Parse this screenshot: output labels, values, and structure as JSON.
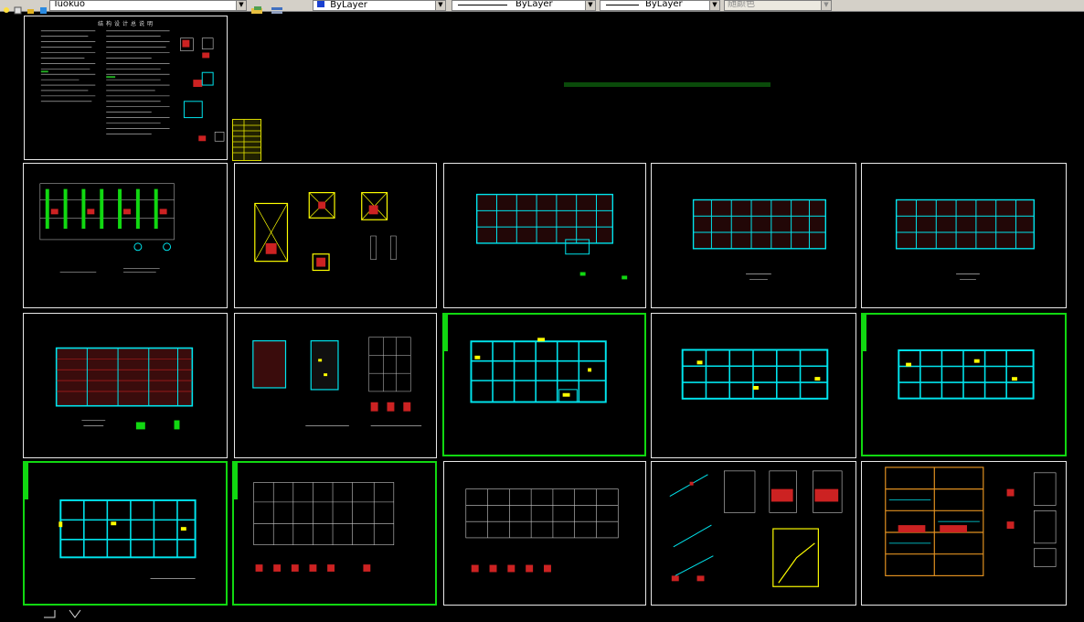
{
  "toolbar": {
    "layer_name": "Tuokuo",
    "color_combo": "ByLayer",
    "linetype_combo": "ByLayer",
    "lineweight_combo": "ByLayer",
    "plotstyle_combo": "随颜色"
  },
  "sheets": {
    "notes_title": "结构设计总说明"
  },
  "colors": {
    "background": "#000000",
    "frame": "#e8e8e8",
    "selection": "#11d811",
    "beam": "#00e5ee",
    "rebar": "#d01010",
    "highlight": "#ffff00"
  }
}
